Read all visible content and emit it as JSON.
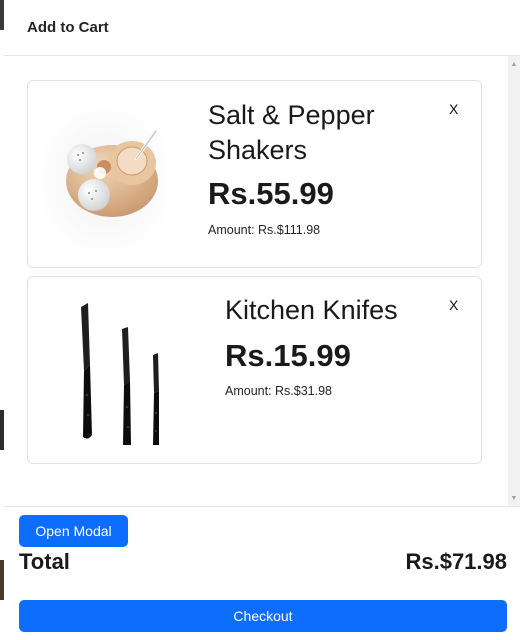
{
  "modal": {
    "title": "Add to Cart"
  },
  "cart_items": [
    {
      "name": "Salt & Pepper Shakers",
      "price": "Rs.55.99",
      "amount": "Amount: Rs.$111.98",
      "remove_label": "X",
      "image_icon": "salt-pepper-shakers-image"
    },
    {
      "name": "Kitchen Knifes",
      "price": "Rs.15.99",
      "amount": "Amount: Rs.$31.98",
      "remove_label": "X",
      "image_icon": "kitchen-knives-image"
    }
  ],
  "footer": {
    "open_modal_label": "Open Modal",
    "total_label": "Total",
    "total_value": "Rs.$71.98",
    "checkout_label": "Checkout"
  },
  "colors": {
    "primary": "#0d6efd",
    "card_border": "#dfe2e6",
    "text": "#1a1a1a"
  }
}
